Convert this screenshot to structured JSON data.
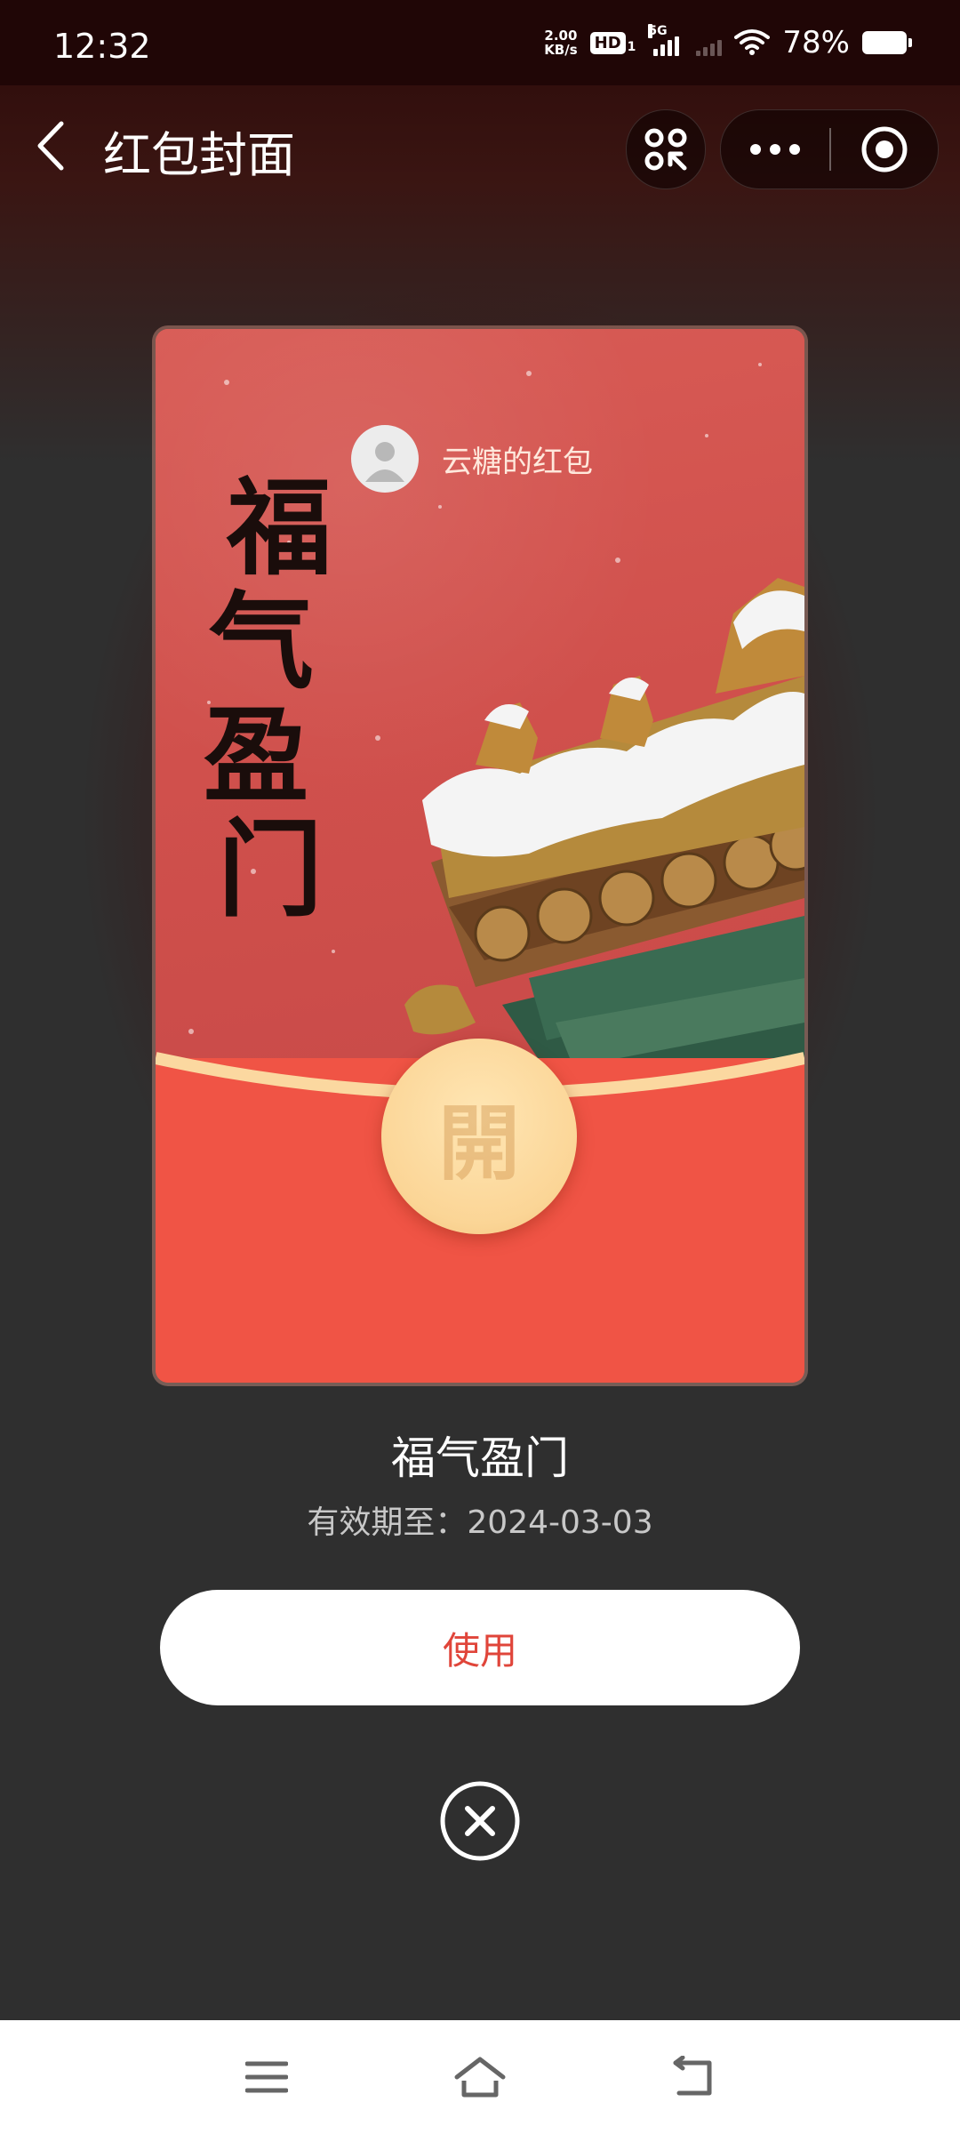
{
  "status_bar": {
    "time": "12:32",
    "net_speed_value": "2.00",
    "net_speed_unit": "KB/s",
    "hd_label": "HD",
    "hd_sub": "1",
    "network_label": "5G",
    "battery_percent": "78%"
  },
  "nav": {
    "title": "红包封面"
  },
  "cover": {
    "sender_name": "云糖的红包",
    "calligraphy_chars": [
      "福",
      "气",
      "盈",
      "门"
    ],
    "open_glyph": "開"
  },
  "info": {
    "name": "福气盈门",
    "expiry": "有效期至：2024-03-03"
  },
  "actions": {
    "use_label": "使用"
  },
  "colors": {
    "accent_red": "#e0453a",
    "envelope_red": "#f05445",
    "open_gold": "#fbd596"
  },
  "icons": {
    "back": "chevron-left-icon",
    "scan": "scan-qr-icon",
    "more": "more-dots-icon",
    "close_miniprogram": "target-circle-icon",
    "close_dialog": "close-circle-icon",
    "sys_menu": "menu-icon",
    "sys_home": "home-icon",
    "sys_back": "back-arrow-icon"
  }
}
